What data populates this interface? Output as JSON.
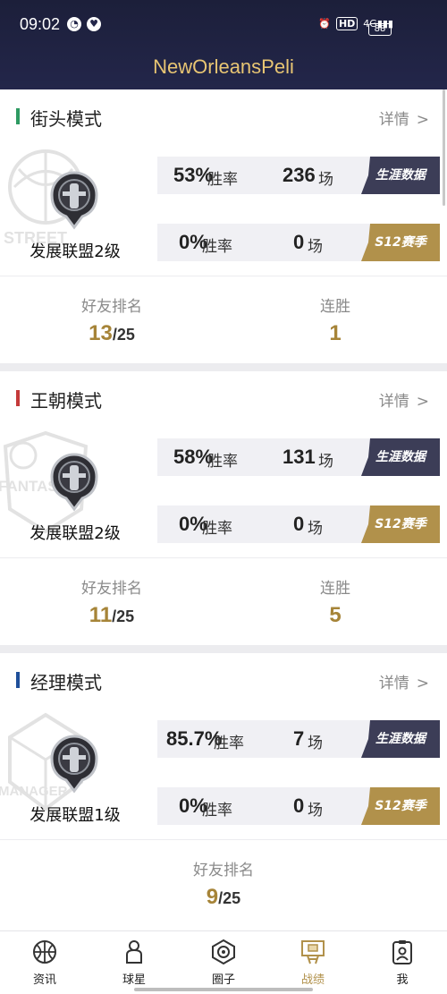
{
  "status": {
    "time": "09:02",
    "network": "4G",
    "hd": "HD",
    "battery": "88"
  },
  "app": {
    "title": "NewOrleansPeli"
  },
  "modes": [
    {
      "title": "街头模式",
      "bar_color": "#2e9a62",
      "detail": "详情",
      "emblem_text": "STREET",
      "level": "发展联盟2级",
      "career": {
        "rate": "53%",
        "rate_label": "胜率",
        "games": "236",
        "games_label": "场",
        "tag": "生涯数据"
      },
      "season": {
        "rate": "0%",
        "rate_label": "胜率",
        "games": "0",
        "games_label": "场",
        "tag": "S12赛季"
      },
      "friend_rank": {
        "label": "好友排名",
        "rank": "13",
        "total": "/25"
      },
      "streak": {
        "label": "连胜",
        "value": "1"
      }
    },
    {
      "title": "王朝模式",
      "bar_color": "#c43a3a",
      "detail": "详情",
      "emblem_text": "FANTAS",
      "level": "发展联盟2级",
      "career": {
        "rate": "58%",
        "rate_label": "胜率",
        "games": "131",
        "games_label": "场",
        "tag": "生涯数据"
      },
      "season": {
        "rate": "0%",
        "rate_label": "胜率",
        "games": "0",
        "games_label": "场",
        "tag": "S12赛季"
      },
      "friend_rank": {
        "label": "好友排名",
        "rank": "11",
        "total": "/25"
      },
      "streak": {
        "label": "连胜",
        "value": "5"
      }
    },
    {
      "title": "经理模式",
      "bar_color": "#1f4f9a",
      "detail": "详情",
      "emblem_text": "MANAGER",
      "level": "发展联盟1级",
      "career": {
        "rate": "85.7%",
        "rate_label": "胜率",
        "games": "7",
        "games_label": "场",
        "tag": "生涯数据"
      },
      "season": {
        "rate": "0%",
        "rate_label": "胜率",
        "games": "0",
        "games_label": "场",
        "tag": "S12赛季"
      },
      "friend_rank": {
        "label": "好友排名",
        "rank": "9",
        "total": "/25"
      }
    }
  ],
  "tabs": [
    {
      "label": "资讯",
      "icon": "basketball-icon"
    },
    {
      "label": "球星",
      "icon": "player-icon"
    },
    {
      "label": "圈子",
      "icon": "circle-hex-icon"
    },
    {
      "label": "战绩",
      "icon": "record-hoop-icon",
      "active": true
    },
    {
      "label": "我",
      "icon": "profile-card-icon"
    }
  ]
}
